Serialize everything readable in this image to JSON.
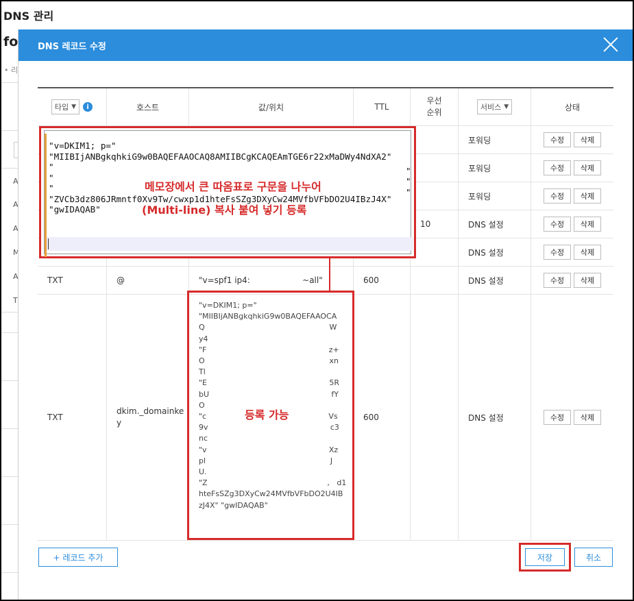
{
  "background": {
    "title": "DNS 관리",
    "fragment": "fo",
    "dot": "• 리",
    "left_letters": [
      "A",
      "A",
      "A",
      "M",
      "A",
      "T"
    ]
  },
  "modal": {
    "title": "DNS 레코드 수정"
  },
  "table": {
    "headers": {
      "type_select": "타입",
      "host": "호스트",
      "value": "값/위치",
      "ttl": "TTL",
      "priority_line1": "우선",
      "priority_line2": "순위",
      "service_select": "서비스",
      "status": "상태"
    },
    "rows": [
      {
        "type": "",
        "host": "",
        "value": "",
        "ttl": "",
        "priority": "",
        "service": "포워딩"
      },
      {
        "type": "",
        "host": "",
        "value": "",
        "ttl": "",
        "priority": "",
        "service": "포워딩"
      },
      {
        "type": "",
        "host": "",
        "value": "",
        "ttl": "",
        "priority": "",
        "service": "포워딩"
      },
      {
        "type": "",
        "host": "",
        "value": "",
        "ttl": "",
        "priority": "10",
        "service": "DNS 설정"
      },
      {
        "type": "",
        "host": "",
        "value": "",
        "ttl": "",
        "priority": "",
        "service": "DNS 설정"
      },
      {
        "type": "TXT",
        "host": "@",
        "value": "\"v=spf1 ip4:                    ~all\"",
        "ttl": "600",
        "priority": "",
        "service": "DNS 설정"
      },
      {
        "type": "TXT",
        "host": "dkim._domainkey",
        "value": "\"v=DKIM1; p=\"\n\"MIIBIjANBgkqhkiG9w0BAQEFAAOCA\nQ                                                    W\ny4\n\"F                                                   z+\nO                                                    xn\nTl\n\"E                                                   5R\nbU                                                   fY\nO\n\"c                                                   Vs\n9v                                                   c3\nnc\n\"v                                                   Xz\npl                                                    J\nU.\n\"Z                                                  ,   d1\nhteFsSZg3DXyCw24MVfbVFbDO2U4IB\nzJ4X\" \"gwIDAQAB\"",
        "ttl": "600",
        "priority": "",
        "service": "DNS 설정"
      }
    ],
    "edit_label": "수정",
    "delete_label": "삭제"
  },
  "notepad": {
    "text": "\"v=DKIM1; p=\"\n\"MIIBIjANBgkqhkiG9w0BAQEFAAOCAQ8AMIIBCgKCAQEAmTGE6r22xMaDWy4NdXA2\"\n\"\n\"\n\"\n\"ZVCb3dz806JRmntf0Xv9Tw/cwxp1d1hteFsSZg3DXyCw24MVfbVFbDO2U4IBzJ4X\"\n\"gwIDAQAB\"",
    "annotation_1": "메모장에서 큰 따옴표로 구문을 나누어",
    "annotation_2": "(Multi-line) 복사 붙여 넣기 등록"
  },
  "registration_note": "등록 가능",
  "footer": {
    "add_record": "+ 레코드 추가",
    "save": "저장",
    "cancel": "취소"
  },
  "colors": {
    "header_blue": "#2b8ddc",
    "annotation_red": "#d62a2a"
  }
}
